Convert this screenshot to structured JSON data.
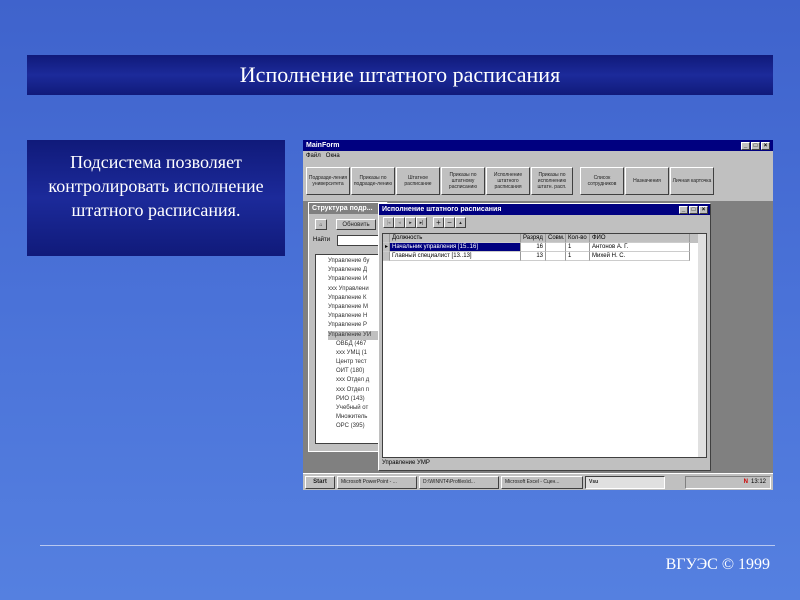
{
  "slide": {
    "title": "Исполнение штатного расписания",
    "description": "Подсистема позволяет контролировать исполнение штатного расписания.",
    "footer": "ВГУЭС © 1999"
  },
  "app": {
    "title": "MainForm",
    "menu": [
      "Файл",
      "Окна"
    ],
    "toolbar": [
      "Подразде-ления университета",
      "Приказы по подразде-лению",
      "Штатное расписание",
      "Приказы по штатному расписанию",
      "Исполнение штатного расписания",
      "Приказы по исполнению штатн. расп.",
      "Список сотрудников",
      "Назначения",
      "Личная карточка"
    ]
  },
  "structure_window": {
    "title": "Структура подр...",
    "refresh": "Обновить",
    "find_label": "Найти",
    "tree": [
      "Управление бу",
      "Управление Д",
      "Управление И",
      "ххх Управлени",
      "Управление К",
      "Управление М",
      "Управление Н",
      "Управление Р",
      "Управление УИ",
      "ОВБД (467",
      "ххх УМЦ (1",
      "Центр тест",
      "ОИТ (180)",
      "ххх Отдел д",
      "ххх Отдел п",
      "РИО (143)",
      "Учебный от",
      "Множитель",
      "ОРС (395)"
    ]
  },
  "exec_window": {
    "title": "Исполнение штатного расписания",
    "columns": [
      "Должность",
      "Разряд",
      "Совм.",
      "Кол-во",
      "ФИО"
    ],
    "rows": [
      [
        "Начальник управления [15..16]",
        "16",
        "",
        "1",
        "Антонов А. Г."
      ],
      [
        "Главный специалист [13..13]",
        "13",
        "",
        "1",
        "Михей Н. С."
      ]
    ],
    "status": "Управление УМР"
  },
  "taskbar": {
    "start": "Start",
    "tasks": [
      "Microsoft PowerPoint - ...",
      "D:\\WINNT4\\Profiles\\d...",
      "Microsoft Excel - Сцен...",
      "Vsu"
    ],
    "clock": "13:12"
  }
}
